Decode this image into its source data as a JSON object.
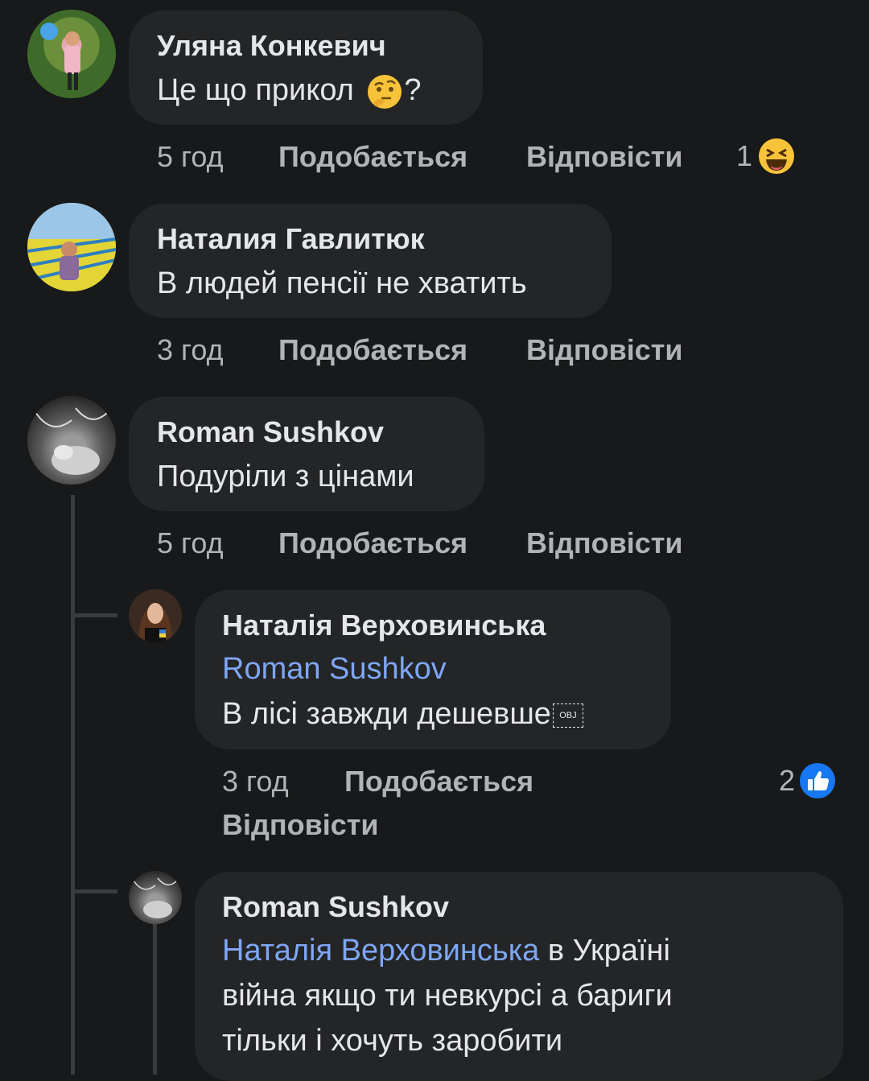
{
  "comments": [
    {
      "author": "Уляна Конкевич",
      "text": "Це що прикол",
      "text_tail": "?",
      "emoji": "thinking-face",
      "time": "5 год",
      "like": "Подобається",
      "reply": "Відповісти",
      "reaction_count": "1",
      "reaction_icon": "laugh-reaction-icon"
    },
    {
      "author": "Наталия Гавлитюк",
      "text": "В людей пенсії не хватить",
      "time": "3 год",
      "like": "Подобається",
      "reply": "Відповісти"
    },
    {
      "author": "Roman Sushkov",
      "text": "Подуріли з цінами",
      "time": "5 год",
      "like": "Подобається",
      "reply": "Відповісти",
      "replies": [
        {
          "author": "Наталія Верховинська",
          "mention": "Roman Sushkov",
          "text": "В лісі завжди дешевше",
          "obj_marker": "OBJ",
          "time": "3 год",
          "like": "Подобається",
          "reply": "Відповісти",
          "reaction_count": "2",
          "reaction_icon": "like-reaction-icon"
        },
        {
          "author": "Roman Sushkov",
          "mention": "Наталія Верховинська",
          "text_line1": "в Україні",
          "text_line2": "війна якщо ти невкурсі а бариги",
          "text_line3": "тільки і хочуть заробити"
        }
      ]
    }
  ],
  "colors": {
    "background": "#18191a",
    "bubble": "#242526",
    "text": "#e4e6eb",
    "meta": "#b0b3b8",
    "mention": "#7ea6f4",
    "like_blue": "#1877f2",
    "laugh_yellow": "#f7c33b"
  }
}
